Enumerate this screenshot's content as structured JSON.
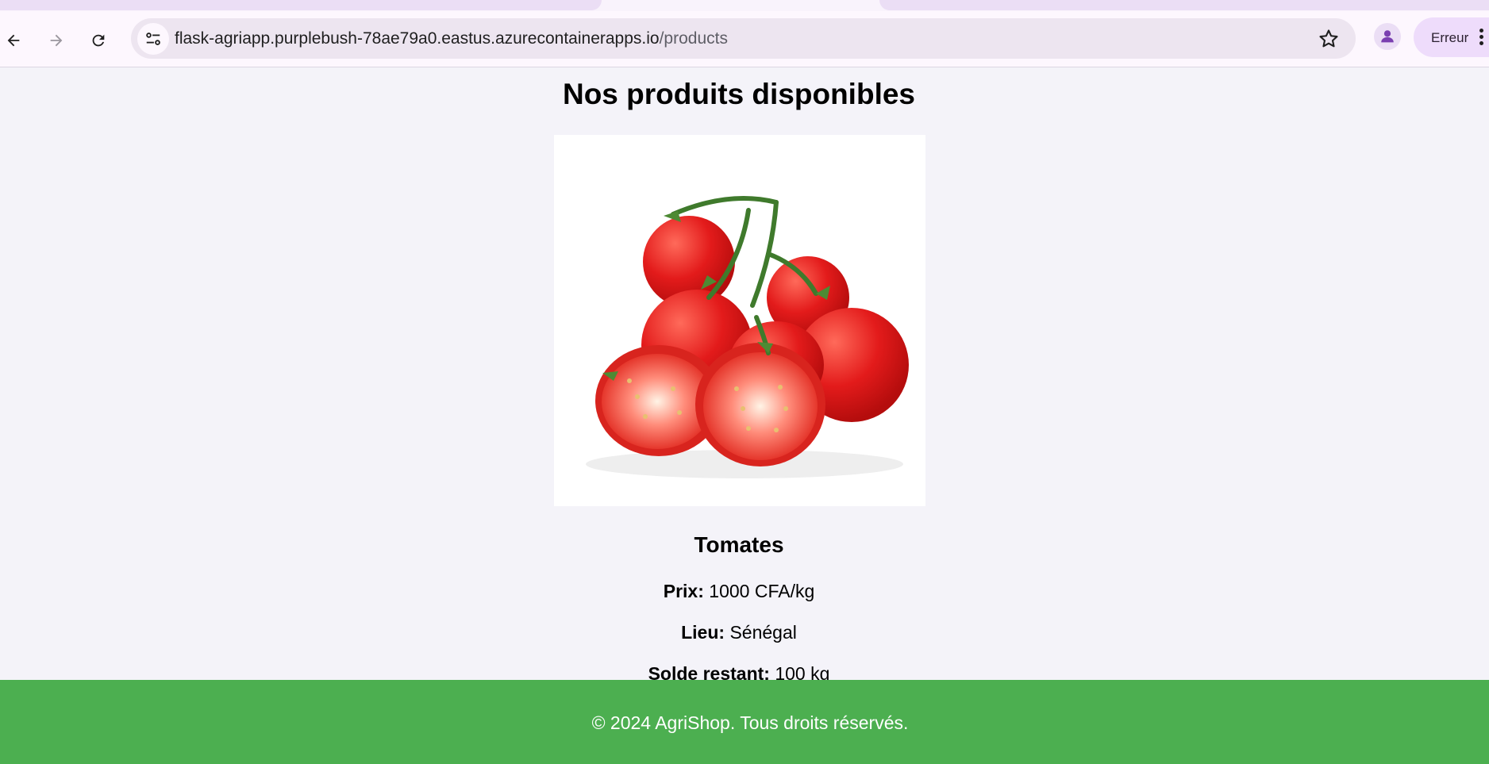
{
  "browser": {
    "url_host": "flask-agriapp.purplebush-78ae79a0.eastus.azurecontainerapps.io",
    "url_path": "/products",
    "profile_status": "Erreur"
  },
  "page": {
    "title": "Nos produits disponibles",
    "product": {
      "name": "Tomates",
      "price_label": "Prix:",
      "price_value": "1000 CFA/kg",
      "location_label": "Lieu:",
      "location_value": "Sénégal",
      "stock_label": "Solde restant:",
      "stock_value": "100 kg"
    },
    "footer": "© 2024 AgriShop. Tous droits réservés."
  },
  "colors": {
    "footer_bg": "#4caf50",
    "page_bg": "#f4f3f9",
    "tomato": "#e31b1b"
  },
  "icons": [
    "back-arrow-icon",
    "forward-arrow-icon",
    "reload-icon",
    "site-settings-icon",
    "bookmark-star-icon",
    "profile-icon",
    "more-vert-icon"
  ]
}
